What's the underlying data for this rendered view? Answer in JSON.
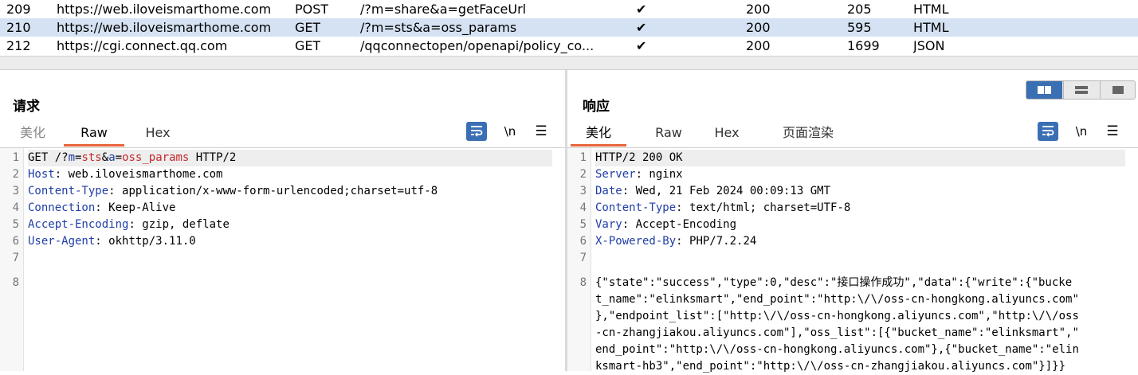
{
  "history": [
    {
      "id": "209",
      "host": "https://web.iloveismarthome.com",
      "method": "POST",
      "url": "/?m=share&a=getFaceUrl",
      "edited": "✔",
      "status": "200",
      "length": "205",
      "mime": "HTML",
      "selected": false
    },
    {
      "id": "210",
      "host": "https://web.iloveismarthome.com",
      "method": "GET",
      "url": "/?m=sts&a=oss_params",
      "edited": "✔",
      "status": "200",
      "length": "595",
      "mime": "HTML",
      "selected": true
    },
    {
      "id": "212",
      "host": "https://cgi.connect.qq.com",
      "method": "GET",
      "url": "/qqconnectopen/openapi/policy_co...",
      "edited": "✔",
      "status": "200",
      "length": "1699",
      "mime": "JSON",
      "selected": false
    }
  ],
  "request": {
    "title": "请求",
    "tabs": [
      "美化",
      "Raw",
      "Hex"
    ],
    "active_tab": "Raw",
    "newline_label": "\\n",
    "menu_icon": "☰",
    "lines": [
      [
        {
          "t": "GET /?",
          "c": ""
        },
        {
          "t": "m",
          "c": "k"
        },
        {
          "t": "=",
          "c": ""
        },
        {
          "t": "sts",
          "c": "v"
        },
        {
          "t": "&",
          "c": ""
        },
        {
          "t": "a",
          "c": "k"
        },
        {
          "t": "=",
          "c": ""
        },
        {
          "t": "oss_params",
          "c": "v"
        },
        {
          "t": " HTTP/2",
          "c": ""
        }
      ],
      [
        {
          "t": "Host",
          "c": "k"
        },
        {
          "t": ": web.iloveismarthome.com",
          "c": ""
        }
      ],
      [
        {
          "t": "Content-Type",
          "c": "k"
        },
        {
          "t": ": application/x-www-form-urlencoded;charset=utf-8",
          "c": ""
        }
      ],
      [
        {
          "t": "Connection",
          "c": "k"
        },
        {
          "t": ": Keep-Alive",
          "c": ""
        }
      ],
      [
        {
          "t": "Accept-Encoding",
          "c": "k"
        },
        {
          "t": ": gzip, deflate",
          "c": ""
        }
      ],
      [
        {
          "t": "User-Agent",
          "c": "k"
        },
        {
          "t": ": okhttp/3.11.0",
          "c": ""
        }
      ],
      [],
      []
    ]
  },
  "response": {
    "title": "响应",
    "tabs": [
      "美化",
      "Raw",
      "Hex",
      "页面渲染"
    ],
    "active_tab": "美化",
    "newline_label": "\\n",
    "menu_icon": "☰",
    "lines": [
      [
        {
          "t": "HTTP/2 200 OK",
          "c": ""
        }
      ],
      [
        {
          "t": "Server",
          "c": "k"
        },
        {
          "t": ": nginx",
          "c": ""
        }
      ],
      [
        {
          "t": "Date",
          "c": "k"
        },
        {
          "t": ": Wed, 21 Feb 2024 00:09:13 GMT",
          "c": ""
        }
      ],
      [
        {
          "t": "Content-Type",
          "c": "k"
        },
        {
          "t": ": text/html; charset=UTF-8",
          "c": ""
        }
      ],
      [
        {
          "t": "Vary",
          "c": "k"
        },
        {
          "t": ": Accept-Encoding",
          "c": ""
        }
      ],
      [
        {
          "t": "X-Powered-By",
          "c": "k"
        },
        {
          "t": ": PHP/7.2.24",
          "c": ""
        }
      ],
      [],
      [
        {
          "t": "{\"state\":\"success\",\"type\":0,\"desc\":\"接口操作成功\",\"data\":{\"write\":{\"bucke",
          "c": ""
        }
      ],
      [
        {
          "t": "t_name\":\"elinksmart\",\"end_point\":\"http:\\/\\/oss-cn-hongkong.aliyuncs.com\"",
          "c": ""
        }
      ],
      [
        {
          "t": "},\"endpoint_list\":[\"http:\\/\\/oss-cn-hongkong.aliyuncs.com\",\"http:\\/\\/oss",
          "c": ""
        }
      ],
      [
        {
          "t": "-cn-zhangjiakou.aliyuncs.com\"],\"oss_list\":[{\"bucket_name\":\"elinksmart\",\"",
          "c": ""
        }
      ],
      [
        {
          "t": "end_point\":\"http:\\/\\/oss-cn-hongkong.aliyuncs.com\"},{\"bucket_name\":\"elin",
          "c": ""
        }
      ],
      [
        {
          "t": "ksmart-hb3\",\"end_point\":\"http:\\/\\/oss-cn-zhangjiakou.aliyuncs.com\"}]}}",
          "c": ""
        }
      ]
    ],
    "line_numbers": [
      "1",
      "2",
      "3",
      "4",
      "5",
      "6",
      "7",
      "8"
    ]
  },
  "colors": {
    "accent": "#3a6fb4",
    "tab_underline": "#e8643c",
    "selected_row": "#d5e2f3",
    "header_key": "#1f3ea6",
    "param_value": "#c4282a"
  }
}
